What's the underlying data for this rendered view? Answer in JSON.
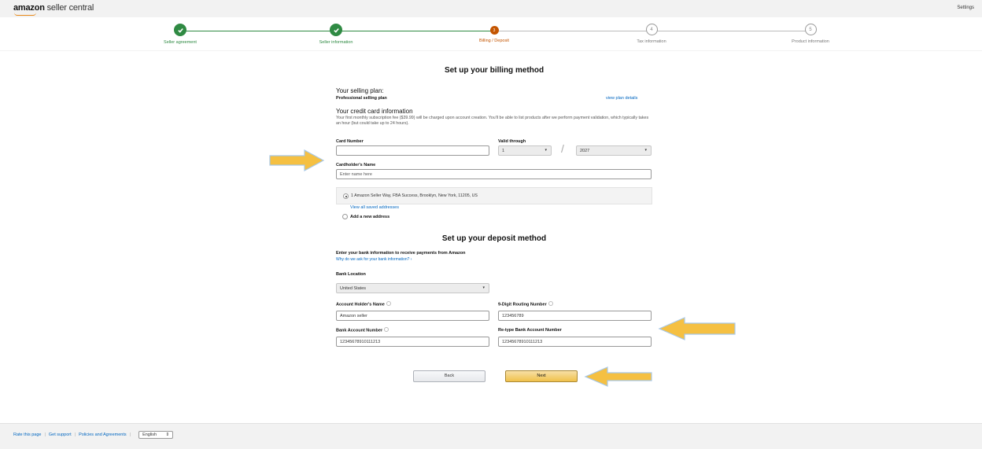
{
  "header": {
    "logo_bold": "amazon",
    "logo_rest": " seller central",
    "settings": "Settings"
  },
  "stepper": {
    "steps": [
      {
        "label": "Seller agreement",
        "state": "done",
        "number": ""
      },
      {
        "label": "Seller information",
        "state": "done",
        "number": ""
      },
      {
        "label": "Billing / Deposit",
        "state": "current",
        "number": "3"
      },
      {
        "label": "Tax information",
        "state": "todo",
        "number": "4"
      },
      {
        "label": "Product information",
        "state": "todo",
        "number": "5"
      }
    ]
  },
  "billing": {
    "title": "Set up your billing method",
    "plan_heading": "Your selling plan:",
    "plan_name": "Professional selling plan",
    "plan_link": "view plan details",
    "cc_heading": "Your credit card information",
    "cc_note": "Your first monthly subscription fee ($39.99) will be charged upon account creation. You'll be able to list products after we perform payment validation, which typically takes an hour (but could take up to 24 hours).",
    "card_number_label": "Card Number",
    "card_number_value": "",
    "valid_through_label": "Valid through",
    "month_value": "1",
    "year_value": "2027",
    "slash": "/",
    "cardholder_label": "Cardholder's Name",
    "cardholder_placeholder": "Enter name here",
    "saved_address": "1 Amazon Seller Way, FBA Success, Brooklyn, New York, 11205, US",
    "view_addresses_link": "View all saved addresses",
    "add_address": "Add a new address"
  },
  "deposit": {
    "title": "Set up your deposit method",
    "intro": "Enter your bank information to receive payments from Amazon",
    "why_link": "Why do we ask for your bank information? ›",
    "bank_location_label": "Bank Location",
    "bank_location_value": "United States",
    "account_holder_label": "Account Holder's Name",
    "account_holder_value": "Amazon seller",
    "routing_label": "9-Digit Routing Number",
    "routing_value": "123456789",
    "account_number_label": "Bank Account Number",
    "account_number_value": "12345678910111213",
    "retype_label": "Re-type Bank Account Number",
    "retype_value": "12345678910111213"
  },
  "buttons": {
    "back": "Back",
    "next": "Next"
  },
  "footer": {
    "rate": "Rate this page",
    "support": "Get support",
    "policies": "Policies and Agreements",
    "language": "English"
  },
  "colors": {
    "done": "#2f8a43",
    "current": "#c45500",
    "link": "#0066c0",
    "annotation_arrow": "#f5c042"
  }
}
